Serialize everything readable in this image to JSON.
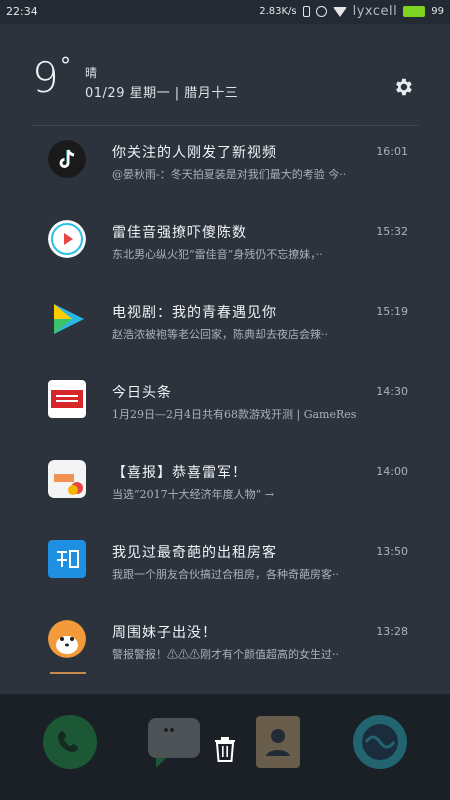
{
  "status_bar": {
    "time": "22:34",
    "net_speed": "2.83K/s",
    "watermark": "lyxcell",
    "battery": "99"
  },
  "weather": {
    "temperature": "9",
    "degree_symbol": "°",
    "condition": "晴",
    "date_line": "01/29  星期一  |  腊月十三"
  },
  "notifications": [
    {
      "app_icon": "tiktok-icon",
      "title": "你关注的人刚发了新视频",
      "time": "16:01",
      "body": "@晏秋雨-：冬天拍夏装是对我们最大的考验 今··",
      "color": "#111111"
    },
    {
      "app_icon": "music-player-icon",
      "title": "雷佳音强撩吓傻陈数",
      "time": "15:32",
      "body": "东北男心纵火犯“雷佳音”身残仍不忘撩妹，··",
      "color": "#e84545"
    },
    {
      "app_icon": "video-player-icon",
      "title": "电视剧：我的青春遇见你",
      "time": "15:19",
      "body": "赵浩浓被袍等老公回家，陈典却去夜店会辣··",
      "color": "#2bb7e6"
    },
    {
      "app_icon": "toutiao-icon",
      "title": "今日头条",
      "time": "14:30",
      "body": "1月29日—2月4日共有68款游戏开测 | GameRes",
      "color": "#d7262b"
    },
    {
      "app_icon": "miui-icon",
      "title": "【喜报】恭喜雷军！",
      "time": "14:00",
      "body": "当选“2017十大经济年度人物” →",
      "color": "#f4f4f4"
    },
    {
      "app_icon": "zhihu-icon",
      "title": "我见过最奇葩的出租房客",
      "time": "13:50",
      "body": "我跟一个朋友合伙搞过合租房，各种奇葩房客··",
      "color": "#1e8fe1"
    },
    {
      "app_icon": "fox-mascot-icon",
      "title": "周围妹子出没！",
      "time": "13:28",
      "body": "警报警报！⚠⚠⚠刚才有个颜值超高的女生过··",
      "color": "#f39a3b"
    }
  ],
  "dock": {
    "apps": [
      "phone-icon",
      "messages-icon",
      "contacts-icon",
      "browser-icon"
    ],
    "clear_icon": "trash-icon"
  }
}
